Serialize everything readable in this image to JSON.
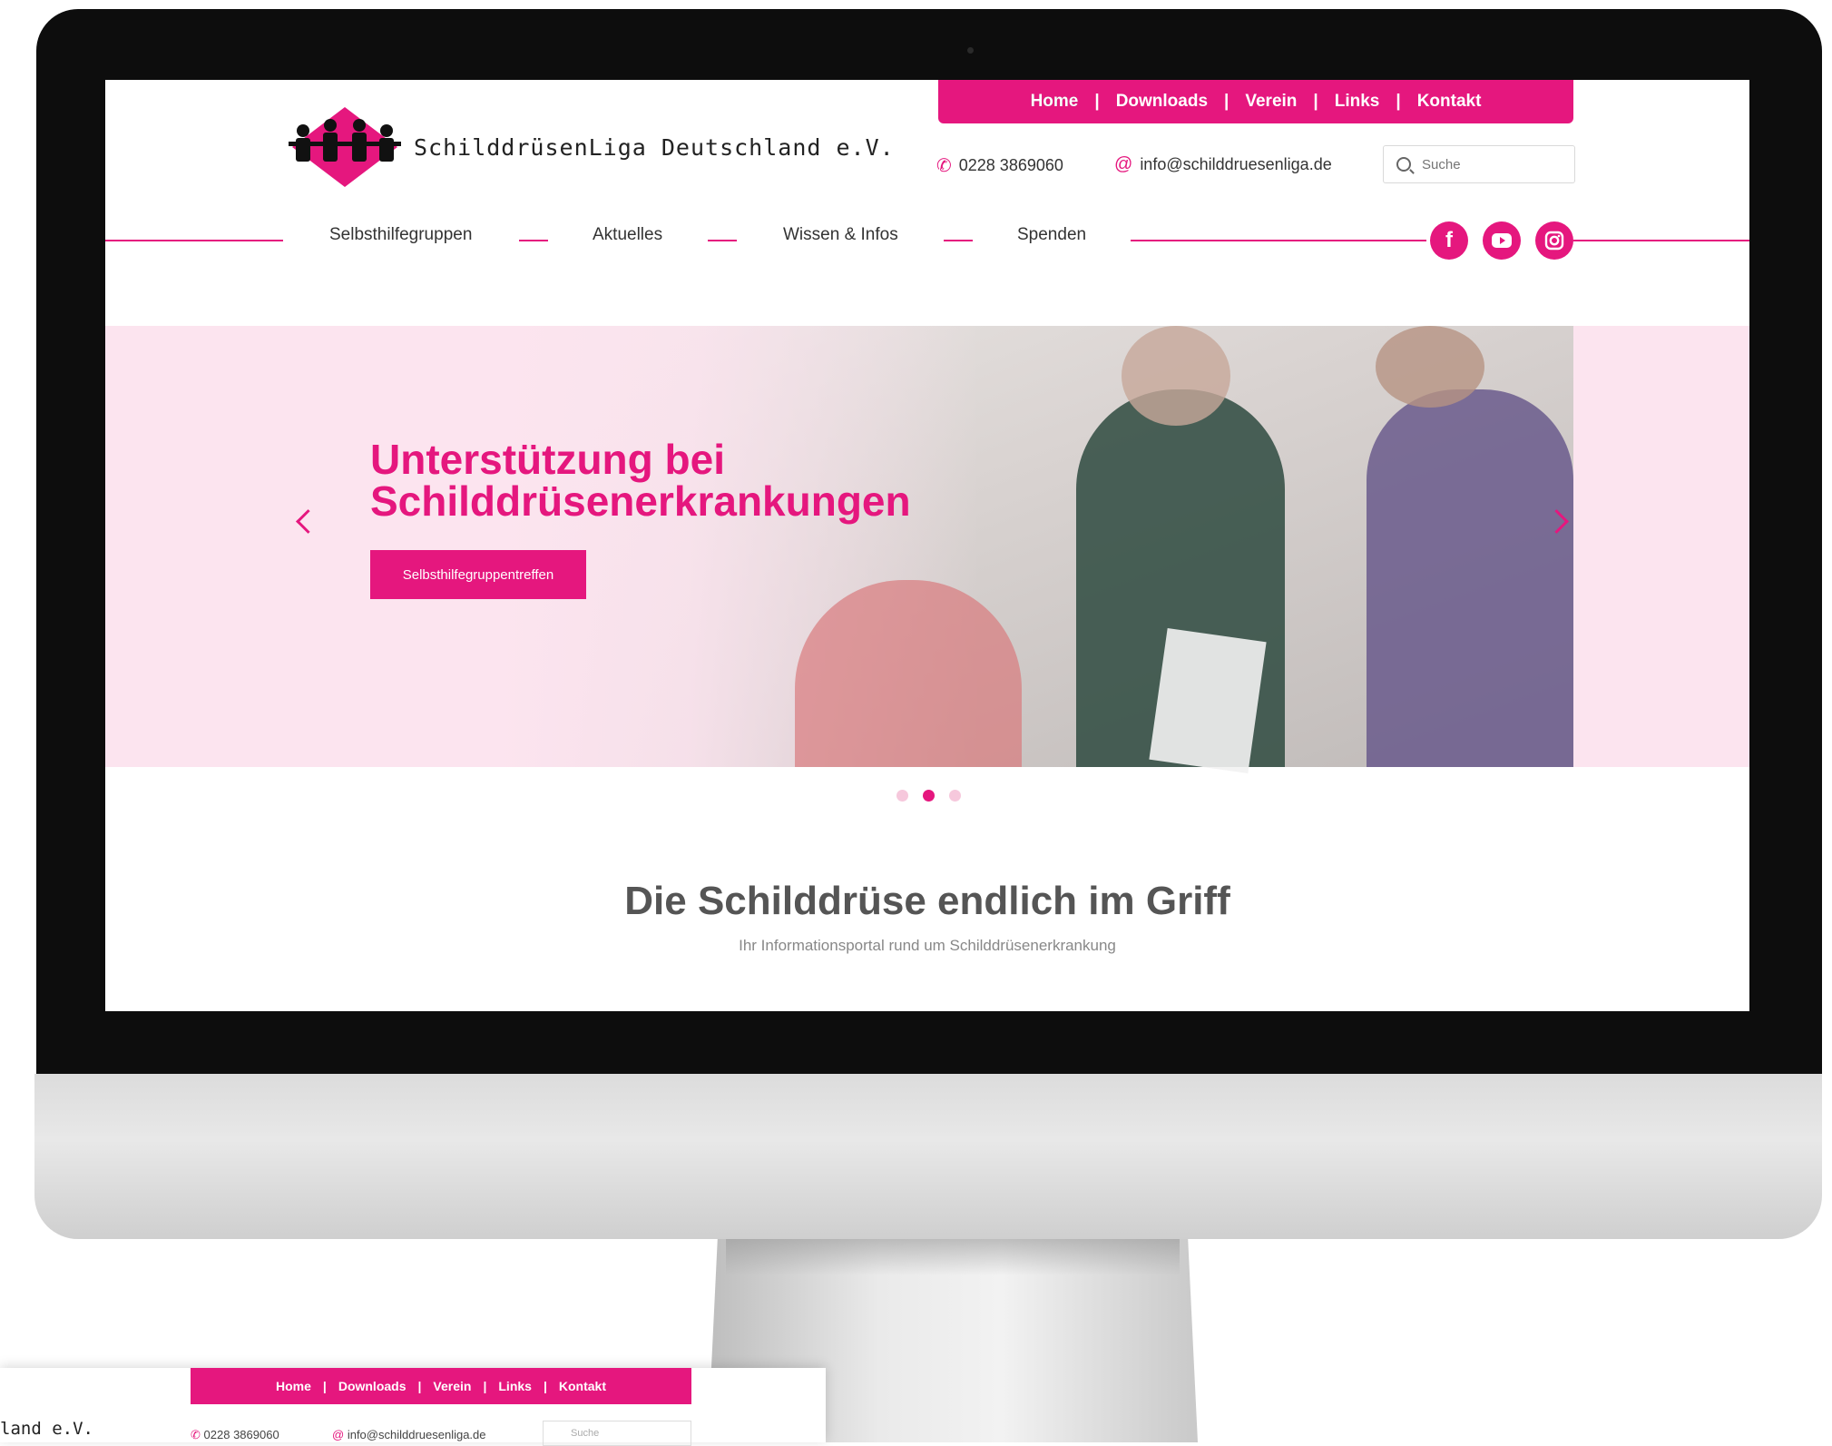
{
  "topnav": {
    "items": [
      "Home",
      "Downloads",
      "Verein",
      "Links",
      "Kontakt"
    ]
  },
  "logo": {
    "name": "SchilddrüsenLiga Deutschland e.V."
  },
  "contact": {
    "phone": "0228 3869060",
    "email": "info@schilddruesenliga.de"
  },
  "search": {
    "placeholder": "Suche"
  },
  "mainnav": {
    "items": [
      "Selbsthilfegruppen",
      "Aktuelles",
      "Wissen & Infos",
      "Spenden"
    ]
  },
  "social": [
    "facebook-icon",
    "youtube-icon",
    "instagram-icon"
  ],
  "hero": {
    "title_line1": "Unterstützung bei",
    "title_line2": "Schilddrüsenerkrankungen",
    "button": "Selbsthilfegruppentreffen",
    "active_slide": 2,
    "slide_count": 3
  },
  "intro": {
    "headline": "Die Schilddrüse endlich im Griff",
    "subline": "Ihr Informationsportal rund um Schilddrüsenerkrankung"
  },
  "mini": {
    "logo_fragment": "land e.V.",
    "phone": "0228 3869060",
    "email": "info@schilddruesenliga.de",
    "search_placeholder": "Suche"
  },
  "colors": {
    "brand": "#e5177e",
    "hero_bg": "#fce4ef"
  }
}
